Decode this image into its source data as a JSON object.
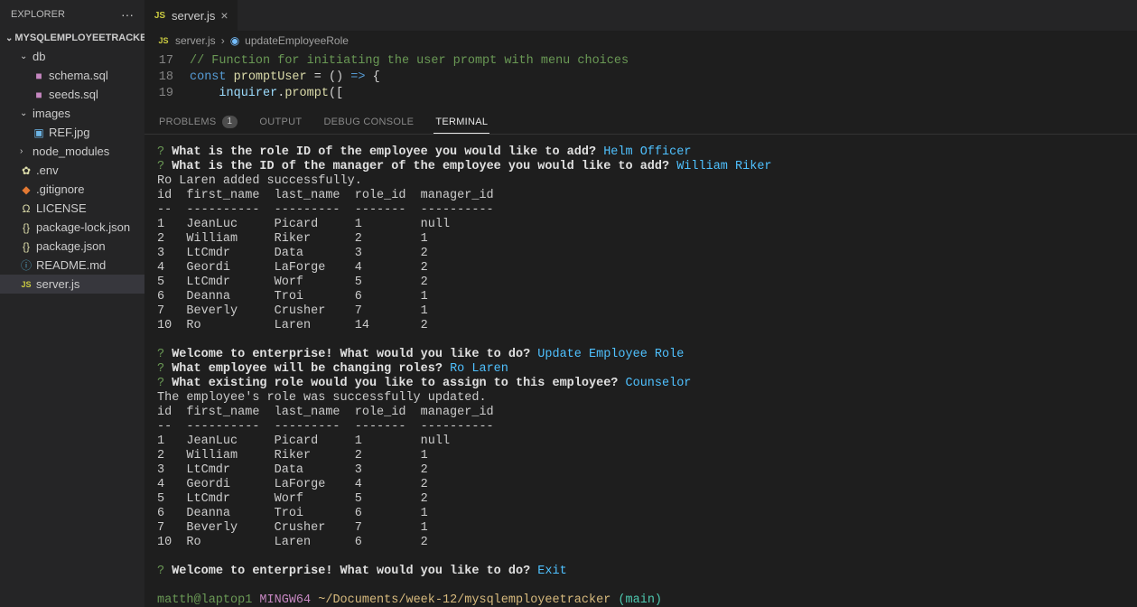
{
  "sidebar": {
    "title": "EXPLORER",
    "project": "MYSQLEMPLOYEETRACKER",
    "tree": {
      "db": "db",
      "schema": "schema.sql",
      "seeds": "seeds.sql",
      "images": "images",
      "ref": "REF.jpg",
      "node_modules": "node_modules",
      "env": ".env",
      "gitignore": ".gitignore",
      "license": "LICENSE",
      "pkglock": "package-lock.json",
      "pkg": "package.json",
      "readme": "README.md",
      "server": "server.js"
    }
  },
  "tabs": {
    "server": {
      "label": "server.js"
    }
  },
  "breadcrumb": {
    "file": "server.js",
    "symbol": "updateEmployeeRole"
  },
  "editor": {
    "lines": {
      "l17": {
        "num": "17",
        "comment": "// Function for initiating the user prompt with menu choices"
      },
      "l18": {
        "num": "18",
        "kw_const": "const",
        "var": "promptUser",
        "eq": " = ",
        "paren": "()",
        "arrow": " => ",
        "brace": "{"
      },
      "l19": {
        "num": "19",
        "indent": "    ",
        "obj": "inquirer",
        "dot": ".",
        "method": "prompt",
        "open": "(["
      }
    }
  },
  "panel": {
    "problems": "PROBLEMS",
    "problems_count": "1",
    "output": "OUTPUT",
    "debug": "DEBUG CONSOLE",
    "terminal": "TERMINAL"
  },
  "term": {
    "q1_mark": "?",
    "q1_text": " What is the role ID of the employee you would like to add? ",
    "q1_ans": "Helm Officer",
    "q2_mark": "?",
    "q2_text": " What is the ID of the manager of the employee you would like to add? ",
    "q2_ans": "William Riker",
    "added": "Ro Laren added successfully.",
    "hdr": "id  first_name  last_name  role_id  manager_id",
    "divider": "--  ----------  ---------  -------  ----------",
    "t1": {
      "r1": "1   JeanLuc     Picard     1        null",
      "r2": "2   William     Riker      2        1",
      "r3": "3   LtCmdr      Data       3        2",
      "r4": "4   Geordi      LaForge    4        2",
      "r5": "5   LtCmdr      Worf       5        2",
      "r6": "6   Deanna      Troi       6        1",
      "r7": "7   Beverly     Crusher    7        1",
      "r8": "10  Ro          Laren      14       2"
    },
    "blank": " ",
    "q3_mark": "?",
    "q3_text": " Welcome to enterprise! What would you like to do? ",
    "q3_ans": "Update Employee Role",
    "q4_mark": "?",
    "q4_text": " What employee will be changing roles? ",
    "q4_ans": "Ro Laren",
    "q5_mark": "?",
    "q5_text": " What existing role would you like to assign to this employee? ",
    "q5_ans": "Counselor",
    "updated": "The employee's role was successfully updated.",
    "t2": {
      "r1": "1   JeanLuc     Picard     1        null",
      "r2": "2   William     Riker      2        1",
      "r3": "3   LtCmdr      Data       3        2",
      "r4": "4   Geordi      LaForge    4        2",
      "r5": "5   LtCmdr      Worf       5        2",
      "r6": "6   Deanna      Troi       6        1",
      "r7": "7   Beverly     Crusher    7        1",
      "r8": "10  Ro          Laren      6        2"
    },
    "q6_mark": "?",
    "q6_text": " Welcome to enterprise! What would you like to do? ",
    "q6_ans": "Exit",
    "prompt_user": "matth@laptop1",
    "prompt_shell": " MINGW64 ",
    "prompt_path": "~/Documents/week-12/mysqlemployeetracker",
    "prompt_branch": " (main)"
  }
}
